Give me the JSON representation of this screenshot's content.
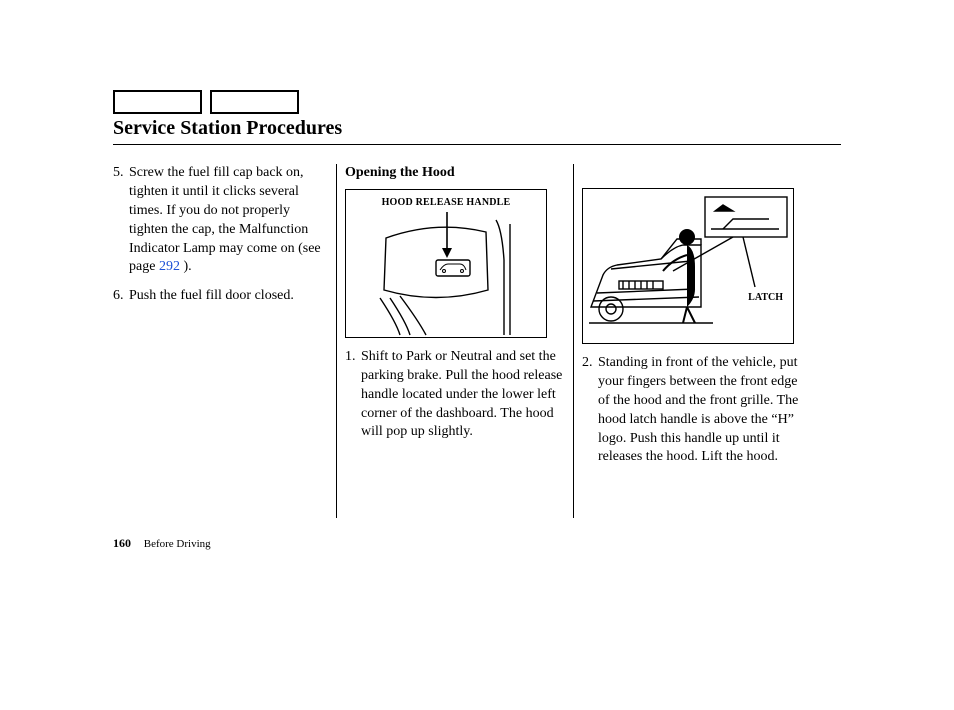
{
  "tabs": {
    "a": "",
    "b": ""
  },
  "title": "Service Station Procedures",
  "col1": {
    "items": [
      {
        "num": "5.",
        "text_a": "Screw the fuel fill cap back on, tighten it until it clicks several times. If you do not properly tighten the cap, the Malfunction Indicator Lamp may come on (see page ",
        "link": "292",
        "text_b": " )."
      },
      {
        "num": "6.",
        "text": "Push the fuel fill door closed."
      }
    ]
  },
  "col2": {
    "subhead": "Opening the Hood",
    "fig_label": "HOOD RELEASE HANDLE",
    "item": {
      "num": "1.",
      "text": "Shift to Park or Neutral and set the parking brake. Pull the hood release handle located under the lower left corner of the dashboard. The hood will pop up slightly."
    }
  },
  "col3": {
    "latch_label": "LATCH",
    "item": {
      "num": "2.",
      "text": "Standing in front of the vehicle, put your fingers between the front edge of the hood and the front grille. The hood latch handle is above the “H” logo. Push this handle up until it releases the hood. Lift the hood."
    }
  },
  "footer": {
    "page": "160",
    "section": "Before Driving"
  }
}
